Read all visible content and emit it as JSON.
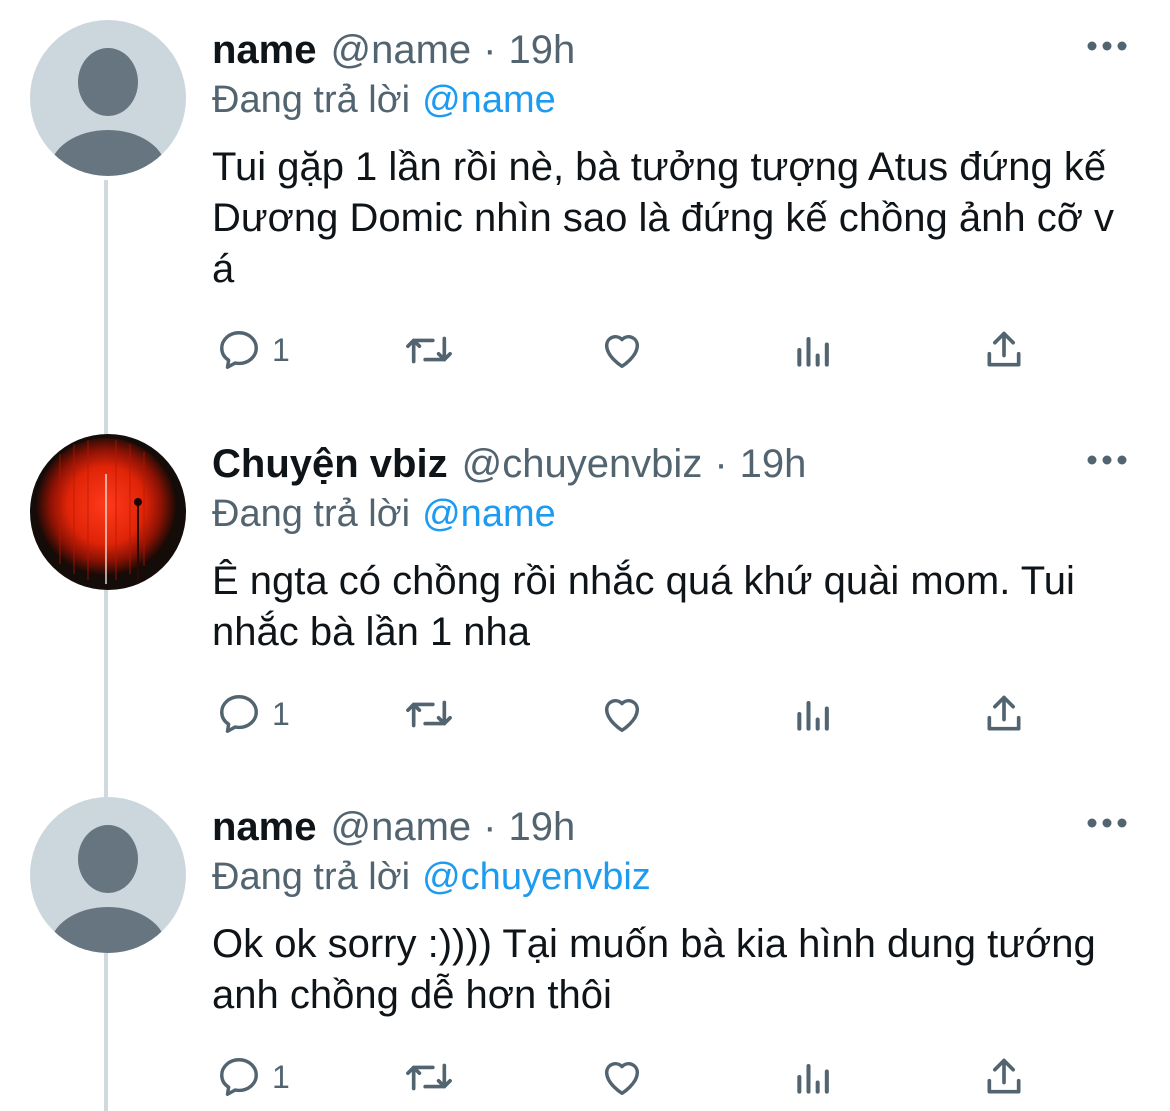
{
  "colors": {
    "text": "#0f1419",
    "secondary": "#536471",
    "link": "#1d9bf0",
    "thread_line": "#cfd9de",
    "avatar_placeholder_bg": "#ccd6dd",
    "avatar_placeholder_fg": "#66757f"
  },
  "tweets": [
    {
      "display_name": "name",
      "handle": "@name",
      "separator": "·",
      "time": "19h",
      "replying_label": "Đang trả lời",
      "replying_to": "@name",
      "text": "Tui gặp 1 lần rồi nè, bà tưởng tượng Atus đứng kế Dương Domic nhìn sao là đứng kế chồng ảnh cỡ v á",
      "reply_count": "1",
      "avatar": "default-avatar-icon"
    },
    {
      "display_name": "Chuyện vbiz",
      "handle": "@chuyenvbiz",
      "separator": "·",
      "time": "19h",
      "replying_label": "Đang trả lời",
      "replying_to": "@name",
      "text": "Ê ngta có chồng rồi nhắc quá khứ quài mom. Tui nhắc bà lần 1 nha",
      "reply_count": "1",
      "avatar": "red-curtain-avatar"
    },
    {
      "display_name": "name",
      "handle": "@name",
      "separator": "·",
      "time": "19h",
      "replying_label": "Đang trả lời",
      "replying_to": "@chuyenvbiz",
      "text": "Ok ok sorry :)))) Tại muốn bà kia hình dung tướng anh chồng dễ hơn thôi",
      "reply_count": "1",
      "avatar": "default-avatar-icon"
    }
  ],
  "action_icons": [
    "reply-icon",
    "retweet-icon",
    "like-icon",
    "analytics-icon",
    "share-icon"
  ]
}
